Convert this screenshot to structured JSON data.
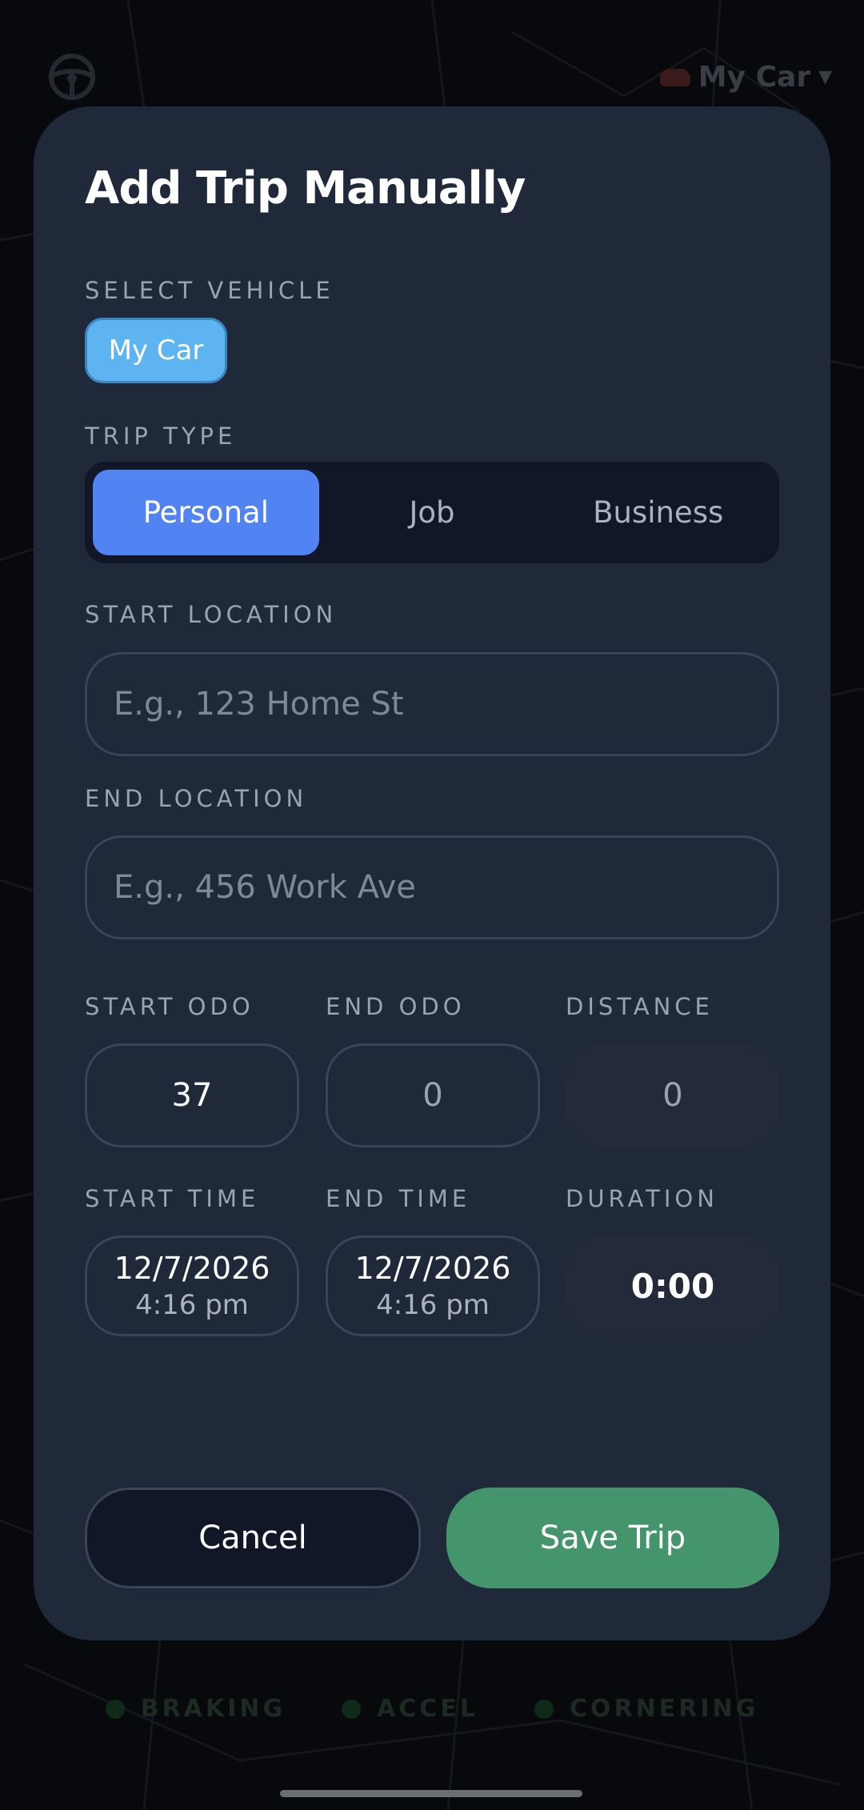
{
  "background": {
    "header_vehicle": "My Car",
    "legend": [
      "BRAKING",
      "ACCEL",
      "CORNERING"
    ],
    "colors": {
      "legend_dot": "#0f2a18"
    }
  },
  "modal": {
    "title": "Add Trip Manually",
    "select_vehicle_label": "SELECT VEHICLE",
    "vehicle_chip": "My Car",
    "trip_type_label": "TRIP TYPE",
    "trip_types": [
      "Personal",
      "Job",
      "Business"
    ],
    "trip_type_selected": "Personal",
    "start_location_label": "START LOCATION",
    "start_location_value": "",
    "start_location_placeholder": "E.g., 123 Home St",
    "end_location_label": "END LOCATION",
    "end_location_value": "",
    "end_location_placeholder": "E.g., 456 Work Ave",
    "odometer": {
      "start_label": "START ODO",
      "start_value": "37",
      "end_label": "END ODO",
      "end_value": "0",
      "distance_label": "DISTANCE",
      "distance_value": "0"
    },
    "times": {
      "start_label": "START TIME",
      "start_date": "12/7/2026",
      "start_time": "4:16 pm",
      "end_label": "END TIME",
      "end_date": "12/7/2026",
      "end_time": "4:16 pm",
      "duration_label": "DURATION",
      "duration_value": "0:00"
    },
    "buttons": {
      "cancel": "Cancel",
      "save": "Save Trip"
    },
    "colors": {
      "modal_bg": "#202939",
      "chip_bg": "#5eb4f0",
      "segment_active": "#5283f3",
      "save_bg": "#45956c",
      "cancel_bg": "#111727"
    }
  }
}
